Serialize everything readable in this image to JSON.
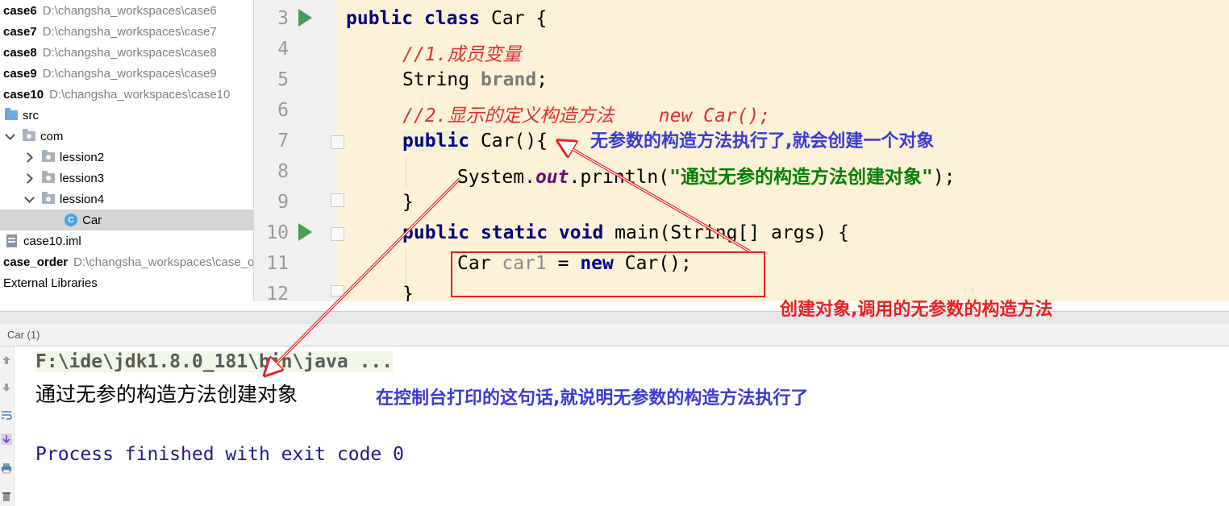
{
  "project_tree": {
    "items": [
      {
        "name": "case6",
        "path": "D:\\changsha_workspaces\\case6"
      },
      {
        "name": "case7",
        "path": "D:\\changsha_workspaces\\case7"
      },
      {
        "name": "case8",
        "path": "D:\\changsha_workspaces\\case8"
      },
      {
        "name": "case9",
        "path": "D:\\changsha_workspaces\\case9"
      },
      {
        "name": "case10",
        "path": "D:\\changsha_workspaces\\case10"
      },
      {
        "name": "src"
      },
      {
        "name": "com"
      },
      {
        "name": "lession2"
      },
      {
        "name": "lession3"
      },
      {
        "name": "lession4"
      },
      {
        "name": "Car",
        "icon": "C"
      },
      {
        "name": "case10.iml"
      },
      {
        "name": "case_order",
        "path": "D:\\changsha_workspaces\\case_o"
      },
      {
        "name": "External Libraries"
      }
    ]
  },
  "editor": {
    "line_numbers": [
      "3",
      "4",
      "5",
      "6",
      "7",
      "8",
      "9",
      "10",
      "11",
      "12"
    ],
    "lines": {
      "l3": {
        "kw1": "public",
        "kw2": "class",
        "rest": " Car {"
      },
      "l4": {
        "comment": "//1.成员变量"
      },
      "l5": {
        "type": "String ",
        "field": "brand",
        "end": ";"
      },
      "l6": {
        "comment": "//2.显示的定义构造方法    new Car();"
      },
      "l7": {
        "kw": "public",
        "rest": " Car(){"
      },
      "l8": {
        "pre": "System.",
        "field": "out",
        "call": ".println(",
        "str": "\"通过无参的构造方法创建对象\"",
        "end": ");"
      },
      "l9": {
        "text": "}"
      },
      "l10": {
        "kw1": "public",
        "kw2": "static",
        "kw3": "void",
        "rest": " main(String[] args) {"
      },
      "l11": {
        "type": "Car ",
        "var": "car1",
        "eq": " = ",
        "kw": "new",
        "rest": " Car();"
      },
      "l12": {
        "text": "}"
      }
    }
  },
  "run_panel": {
    "tab_title": "Car (1)",
    "command": "F:\\ide\\jdk1.8.0_181\\bin\\java ...",
    "output": "通过无参的构造方法创建对象",
    "exit": "Process finished with exit code 0"
  },
  "annotations": {
    "constructor_note": "无参数的构造方法执行了,就会创建一个对象",
    "create_note": "创建对象,调用的无参数的构造方法",
    "console_note": "在控制台打印的这句话,就说明无参数的构造方法执行了"
  },
  "colors": {
    "annotation_blue": "#3a3ad8",
    "annotation_red": "#e82020",
    "keyword": "#000080",
    "comment": "#e03030",
    "string": "#008000",
    "editor_bg": "#fdf2d8"
  }
}
